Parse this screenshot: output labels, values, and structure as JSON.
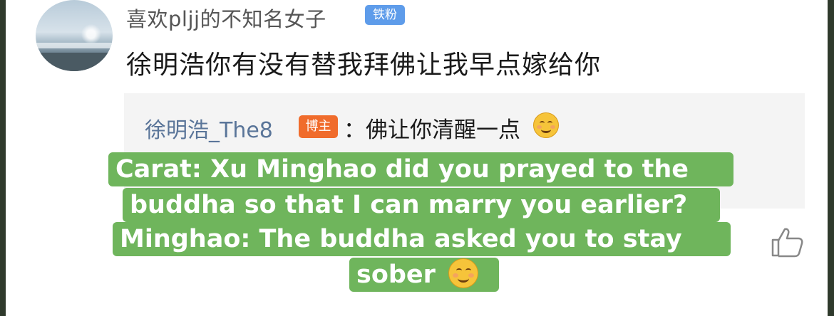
{
  "comment": {
    "username": "喜欢pljj的不知名女子",
    "fan_badge": "铁粉",
    "text": "徐明浩你有没有替我拜佛让我早点嫁给你"
  },
  "reply": {
    "name": "徐明浩_The8",
    "host_badge": "博主",
    "text": "：佛让你清醒一点",
    "emoji": "smile-emoji"
  },
  "actions": {
    "like_icon": "thumbs-up-icon"
  },
  "caption": {
    "line1": "Carat: Xu Minghao did you prayed to the",
    "line2": "buddha so that I can marry you earlier?",
    "line3": "Minghao: The buddha asked you to stay",
    "line4": "sober"
  },
  "colors": {
    "caption_bg": "#6fb55c",
    "host_badge": "#f06c2c",
    "fan_badge": "#5e9cea",
    "reply_name": "#5a7599"
  }
}
